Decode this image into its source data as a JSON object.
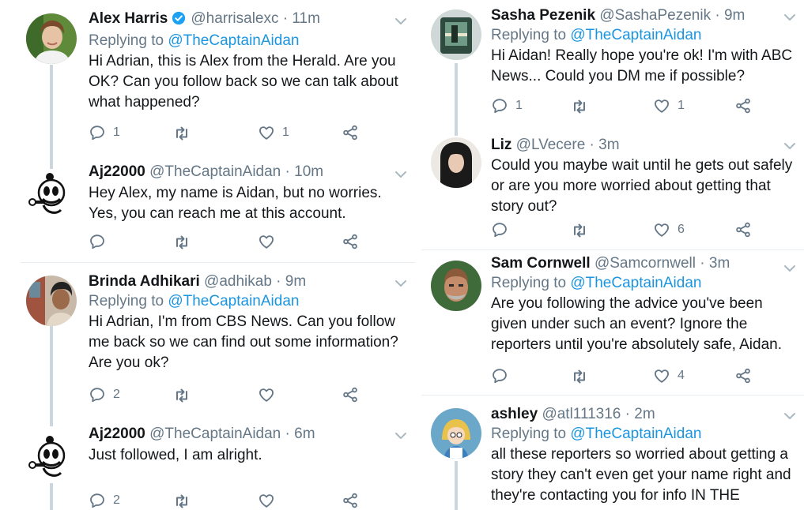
{
  "left": [
    {
      "name": "Alex Harris",
      "verified": true,
      "handle": "@harrisalexc",
      "time": "11m",
      "replying_prefix": "Replying to",
      "replying_to": "@TheCaptainAidan",
      "text": "Hi Adrian, this is Alex from the Herald. Are you OK? Can you follow back so we can talk about what happened?",
      "replies": "1",
      "retweets": "",
      "likes": "1",
      "avatar": "woman-portrait"
    },
    {
      "name": "Aj22000",
      "handle": "@TheCaptainAidan",
      "time": "10m",
      "text": "Hey Alex, my name is Aidan, but no worries. Yes, you can reach me at this account.",
      "replies": "",
      "retweets": "",
      "likes": "",
      "avatar": "cartoon-mascot"
    },
    {
      "name": "Brinda Adhikari",
      "handle": "@adhikab",
      "time": "9m",
      "replying_prefix": "Replying to",
      "replying_to": "@TheCaptainAidan",
      "text": "Hi Adrian, I'm from CBS News. Can you follow me back so we can find out some information? Are you ok?",
      "replies": "2",
      "retweets": "",
      "likes": "",
      "avatar": "woman-selfie"
    },
    {
      "name": "Aj22000",
      "handle": "@TheCaptainAidan",
      "time": "6m",
      "text": "Just followed, I am alright.",
      "replies": "2",
      "retweets": "",
      "likes": "",
      "avatar": "cartoon-mascot"
    }
  ],
  "right": [
    {
      "name": "Sasha Pezenik",
      "handle": "@SashaPezenik",
      "time": "9m",
      "replying_prefix": "Replying to",
      "replying_to": "@TheCaptainAidan",
      "text": "Hi Aidan! Really hope you're ok! I'm with ABC News... Could you DM me if possible?",
      "replies": "1",
      "retweets": "",
      "likes": "1",
      "avatar": "subway-photo"
    },
    {
      "name": "Liz",
      "handle": "@LVecere",
      "time": "3m",
      "text": "Could you maybe wait until he gets out safely or are you more worried about getting that story out?",
      "replies": "",
      "retweets": "",
      "likes": "6",
      "avatar": "dark-hair-woman"
    },
    {
      "name": "Sam Cornwell",
      "handle": "@Samcornwell",
      "time": "3m",
      "replying_prefix": "Replying to",
      "replying_to": "@TheCaptainAidan",
      "text": "Are you following the advice you've been given under such an event? Ignore the reporters until you're absolutely safe, Aidan.",
      "replies": "",
      "retweets": "",
      "likes": "4",
      "avatar": "man-face"
    },
    {
      "name": "ashley",
      "handle": "@atl111316",
      "time": "2m",
      "replying_prefix": "Replying to",
      "replying_to": "@TheCaptainAidan",
      "text": "all these reporters so worried about getting a story they can't even get your name right and they're contacting you for info IN THE",
      "replies": "",
      "retweets": "",
      "likes": "",
      "avatar": "cartoon-girl"
    }
  ],
  "colors": {
    "link": "#1b95e0",
    "secondary": "#657786",
    "thread_line": "#ccd6dd",
    "separator": "#e6ecf0",
    "text": "#14171a"
  }
}
